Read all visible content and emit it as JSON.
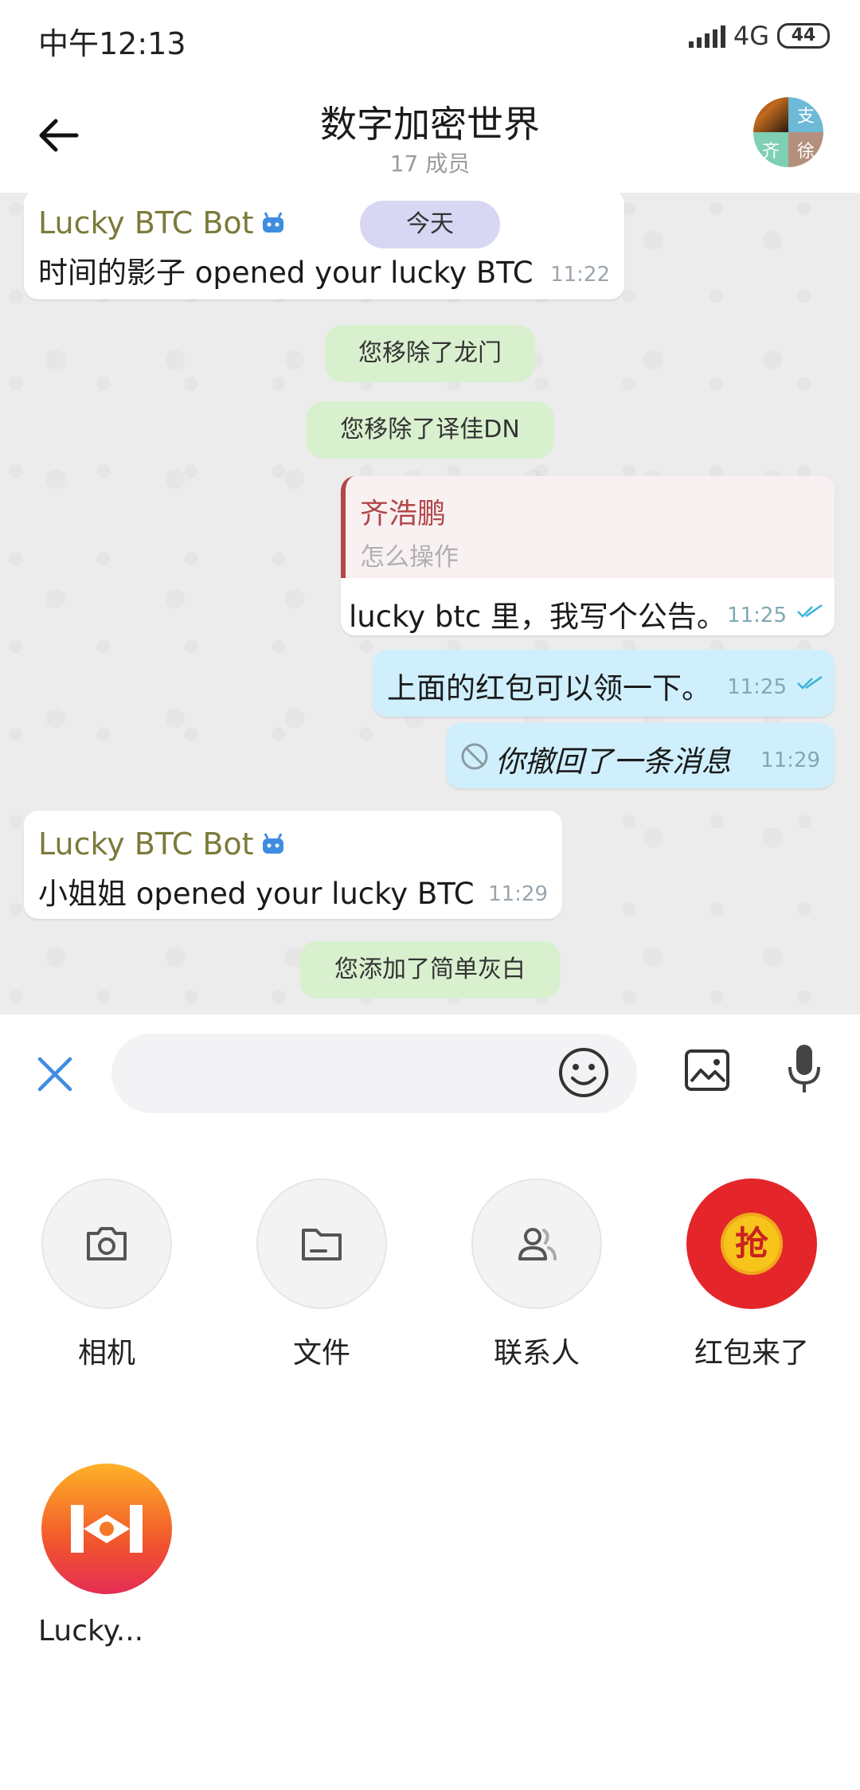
{
  "status_bar": {
    "time": "中午12:13",
    "network": "4G",
    "battery": "44"
  },
  "header": {
    "title": "数字加密世界",
    "subtitle": "17 成员",
    "avatar_tiles": [
      "",
      "支",
      "齐",
      "徐"
    ]
  },
  "chat": {
    "day_chip": "今天",
    "messages": [
      {
        "sender": "Lucky BTC Bot",
        "text": "时间的影子 opened your lucky BTC",
        "time": "11:22"
      },
      {
        "system": "您移除了龙门"
      },
      {
        "system": "您移除了译佳DN"
      },
      {
        "reply_to_name": "齐浩鹏",
        "reply_to_text": "怎么操作",
        "text": "lucky btc 里，我写个公告。",
        "time": "11:25"
      },
      {
        "text": "上面的红包可以领一下。",
        "time": "11:25"
      },
      {
        "text": "你撤回了一条消息",
        "time": "11:29"
      },
      {
        "sender": "Lucky BTC Bot",
        "text": "小姐姐 opened your lucky BTC",
        "time": "11:29"
      },
      {
        "system": "您添加了简单灰白"
      }
    ]
  },
  "input": {
    "placeholder": "",
    "value": ""
  },
  "attachments": [
    {
      "label": "相机",
      "icon": "camera-icon"
    },
    {
      "label": "文件",
      "icon": "folder-icon"
    },
    {
      "label": "联系人",
      "icon": "contact-icon"
    },
    {
      "label": "红包来了",
      "icon": "red-envelope-icon",
      "badge": "抢"
    },
    {
      "label": "Lucky...",
      "icon": "lucky-app-icon"
    }
  ],
  "colors": {
    "accent": "#3f8de0",
    "sender": "#7b7a3a",
    "reply_name": "#b1474b",
    "red_envelope": "#e4262a"
  }
}
